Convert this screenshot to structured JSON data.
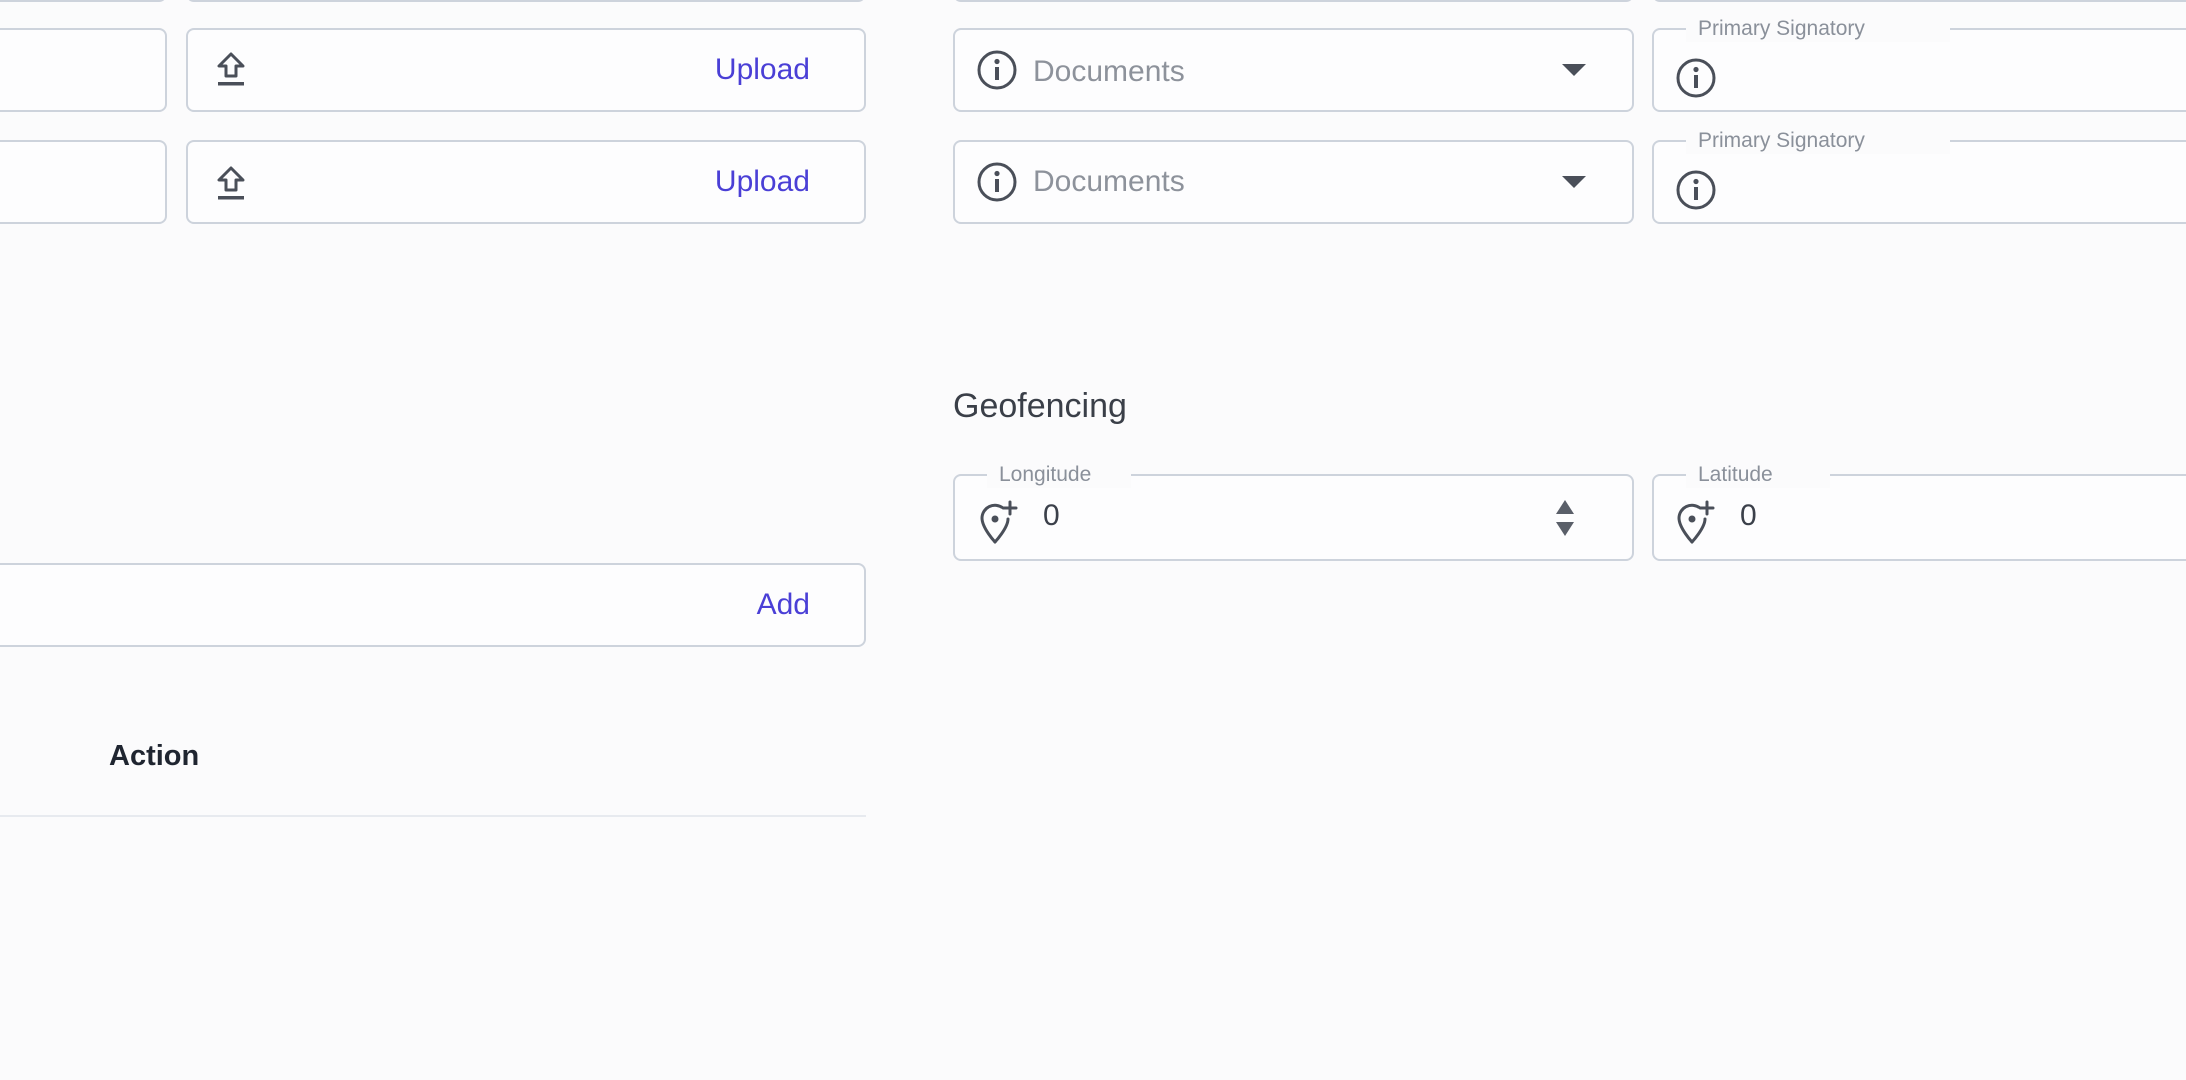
{
  "upload_rows": [
    {
      "button_label": "Upload"
    },
    {
      "button_label": "Upload"
    }
  ],
  "document_rows": [
    {
      "select_placeholder": "Documents",
      "signatory_label": "Primary Signatory"
    },
    {
      "select_placeholder": "Documents",
      "signatory_label": "Primary Signatory"
    }
  ],
  "add_field": {
    "button_label": "Add"
  },
  "table": {
    "columns": [
      "Action"
    ]
  },
  "geofencing": {
    "title": "Geofencing",
    "longitude": {
      "label": "Longitude",
      "value": "0"
    },
    "latitude": {
      "label": "Latitude",
      "value": "0"
    }
  },
  "icons": {
    "upload": "upload-icon",
    "info": "info-icon",
    "dropdown": "caret-down-icon",
    "location": "add-location-icon",
    "stepper": "number-stepper-icon"
  },
  "colors": {
    "accent": "#4a3fd6",
    "border": "#cdd3dc",
    "muted_text": "#8d929b"
  }
}
